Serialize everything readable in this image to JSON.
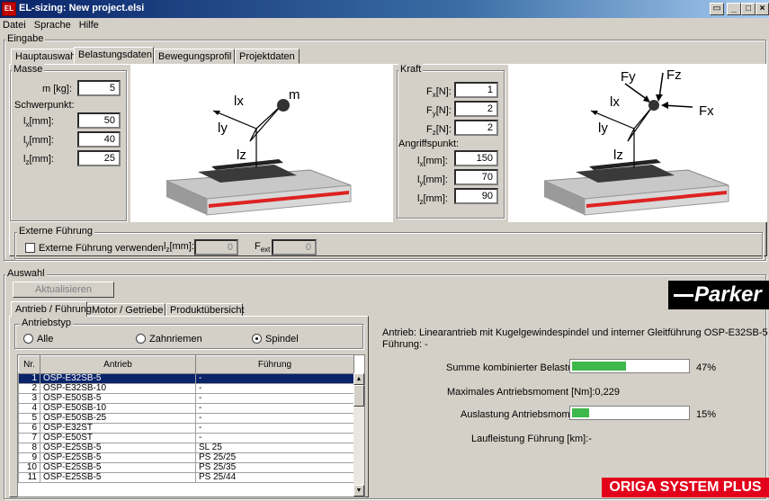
{
  "window": {
    "title": "EL-sizing: New project.elsi",
    "app_icon": "EL"
  },
  "menu": {
    "items": [
      "Datei",
      "Sprache",
      "Hilfe"
    ]
  },
  "eingabe": {
    "label": "Eingabe",
    "tabs": [
      "Hauptauswahl",
      "Belastungsdaten",
      "Bewegungsprofil",
      "Projektdaten"
    ],
    "masse": {
      "label": "Masse",
      "m_label": "m [kg]:",
      "m_value": "5",
      "schwerpunkt_label": "Schwerpunkt:",
      "lx_label": "lx[mm]:",
      "lx_value": "50",
      "ly_label": "ly[mm]:",
      "ly_value": "40",
      "lz_label": "lz[mm]:",
      "lz_value": "25"
    },
    "diagram_mass": {
      "lx": "lx",
      "ly": "ly",
      "lz": "lz",
      "m": "m"
    },
    "kraft": {
      "label": "Kraft",
      "fx_label": "Fx[N]:",
      "fx_value": "1",
      "fy_label": "Fy[N]:",
      "fy_value": "2",
      "fz_label": "Fz[N]:",
      "fz_value": "2",
      "angriffspunkt_label": "Angriffspunkt:",
      "lx_label": "lx[mm]:",
      "lx_value": "150",
      "ly_label": "ly[mm]:",
      "ly_value": "70",
      "lz_label": "lz[mm]:",
      "lz_value": "90"
    },
    "diagram_force": {
      "fy": "Fy",
      "fz": "Fz",
      "fx": "Fx",
      "lx": "lx",
      "ly": "ly",
      "lz": "lz"
    },
    "externe": {
      "label": "Externe Führung",
      "checkbox_label": "Externe Führung verwenden",
      "lz_label": "lz[mm]:",
      "lz_value": "0",
      "fext_label": "Fext",
      "fext_value": "0"
    }
  },
  "auswahl": {
    "label": "Auswahl",
    "refresh_label": "Aktualisieren",
    "logo": "Parker",
    "tabs": [
      "Antrieb / Führung",
      "Motor / Getriebe",
      "Produktübersicht"
    ],
    "antriebstyp": {
      "label": "Antriebstyp",
      "options": [
        "Alle",
        "Zahnriemen",
        "Spindel"
      ],
      "selected": "Spindel"
    },
    "table": {
      "headers": [
        "Nr.",
        "Antrieb",
        "Führung"
      ],
      "rows": [
        [
          "1",
          "OSP-E32SB-5",
          "-"
        ],
        [
          "2",
          "OSP-E32SB-10",
          "-"
        ],
        [
          "3",
          "OSP-E50SB-5",
          "-"
        ],
        [
          "4",
          "OSP-E50SB-10",
          "-"
        ],
        [
          "5",
          "OSP-E50SB-25",
          "-"
        ],
        [
          "6",
          "OSP-E32ST",
          "-"
        ],
        [
          "7",
          "OSP-E50ST",
          "-"
        ],
        [
          "8",
          "OSP-E25SB-5",
          "SL 25"
        ],
        [
          "9",
          "OSP-E25SB-5",
          "PS 25/25"
        ],
        [
          "10",
          "OSP-E25SB-5",
          "PS 25/35"
        ],
        [
          "11",
          "OSP-E25SB-5",
          "PS 25/44"
        ]
      ],
      "selected_row": 0
    },
    "info": {
      "antrieb_text": "Antrieb: Linearantrieb mit Kugelgewindespindel und interner Gleitführung OSP-E32SB-5",
      "fuehrung_text": "Führung: -",
      "summe_label": "Summe kombinierter Belastungen:",
      "summe_value": "47%",
      "summe_fraction": 0.47,
      "moment_text": "Maximales Antriebsmoment [Nm]:0,229",
      "auslastung_label": "Auslastung Antriebsmoment:",
      "auslastung_value": "15%",
      "auslastung_fraction": 0.15,
      "laufleistung_text": "Laufleistung Führung [km]:-"
    },
    "brand": "ORIGA SYSTEM PLUS"
  },
  "colors": {
    "title_bar": "#0a246a",
    "selection": "#0a246a",
    "progress": "#3db84a",
    "brand": "#e3001b"
  }
}
